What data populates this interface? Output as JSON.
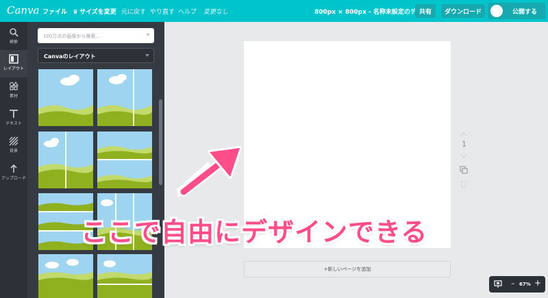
{
  "topbar": {
    "logo": "Canva",
    "file_label": "ファイル",
    "resize_label": "サイズを変更",
    "undo_label": "元に戻す",
    "redo_label": "やり直す",
    "help_label": "ヘルプ",
    "status": "変更なし",
    "dimension_title": "800px × 800px - 名称未設定のデザイン",
    "share_label": "共有",
    "download_label": "ダウンロード",
    "publish_label": "公開する"
  },
  "rail": {
    "items": [
      {
        "label": "検索",
        "icon": "search-icon"
      },
      {
        "label": "レイアウト",
        "icon": "layout-icon",
        "active": true
      },
      {
        "label": "素材",
        "icon": "elements-icon"
      },
      {
        "label": "テキスト",
        "icon": "text-icon"
      },
      {
        "label": "背景",
        "icon": "background-icon"
      },
      {
        "label": "アップロード",
        "icon": "upload-icon"
      }
    ]
  },
  "panel": {
    "search_placeholder": "100万点の画像から検索...",
    "layout_select": "Canvaのレイアウト"
  },
  "canvas": {
    "page_number": "1",
    "add_page_label": "+新しいページを追加"
  },
  "annotation": {
    "text": "ここで自由にデザインできる"
  },
  "zoom": {
    "minus": "–",
    "level": "67%",
    "plus": "+"
  },
  "colors": {
    "brand": "#00c4cc",
    "annotation": "#ff4d8a",
    "sky": "#9ed4ef",
    "grass": "#8fb11f"
  }
}
